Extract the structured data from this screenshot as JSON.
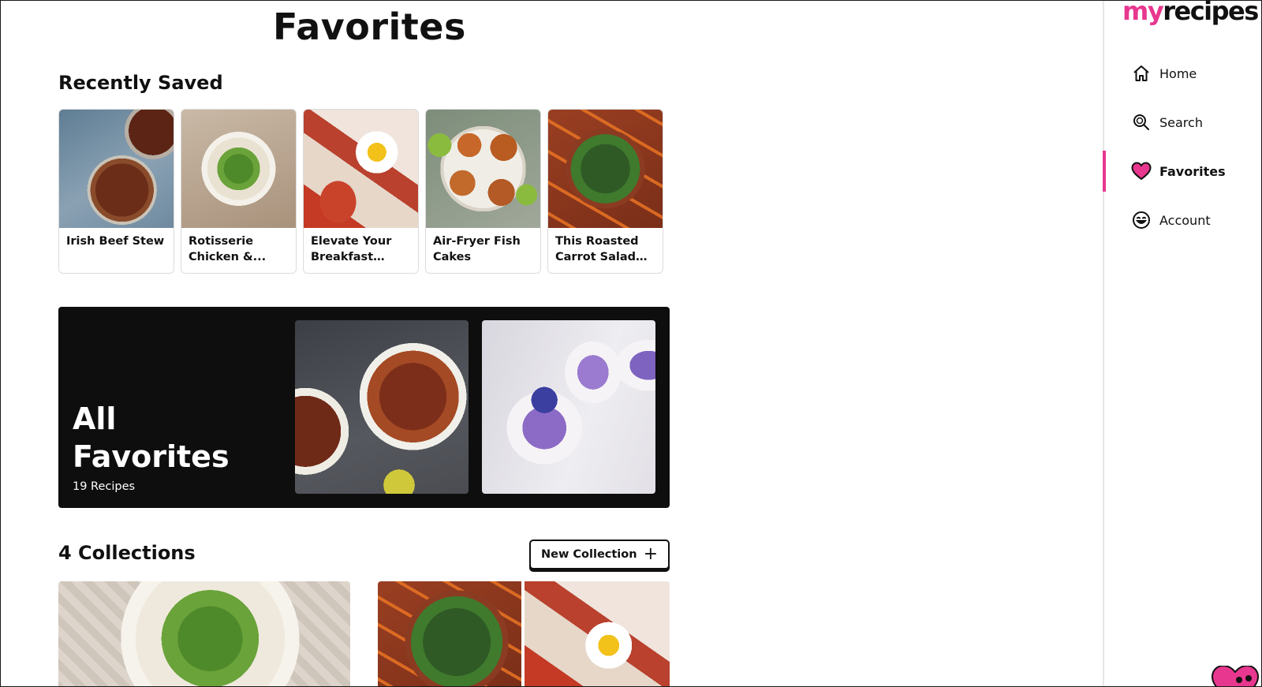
{
  "page": {
    "title": "Favorites"
  },
  "recently_saved": {
    "heading": "Recently Saved",
    "cards": [
      {
        "title": "Irish Beef Stew",
        "image": "beef-stew-photo"
      },
      {
        "title": "Rotisserie Chicken &...",
        "image": "rotisserie-chicken-salad-photo"
      },
      {
        "title": "Elevate Your Breakfast Gam...",
        "image": "bacon-egg-toast-photo"
      },
      {
        "title": "Air-Fryer Fish Cakes",
        "image": "fish-cakes-photo"
      },
      {
        "title": "This Roasted Carrot Salad Is...",
        "image": "roasted-carrot-salad-photo"
      }
    ]
  },
  "all_favorites": {
    "title_line1": "All",
    "title_line2": "Favorites",
    "count": "19 Recipes",
    "images": [
      "bean-soup-photo",
      "blueberry-parfait-photo"
    ]
  },
  "collections": {
    "heading": "4 Collections",
    "new_button_label": "New Collection",
    "new_button_icon": "plus-icon"
  },
  "sidebar": {
    "logo_my": "my",
    "logo_recipes": "recipes",
    "accent_color": "#e8378e",
    "nav": [
      {
        "label": "Home",
        "icon": "home-icon"
      },
      {
        "label": "Search",
        "icon": "search-icon"
      },
      {
        "label": "Favorites",
        "icon": "heart-icon",
        "active": true
      },
      {
        "label": "Account",
        "icon": "smiley-icon"
      }
    ]
  }
}
